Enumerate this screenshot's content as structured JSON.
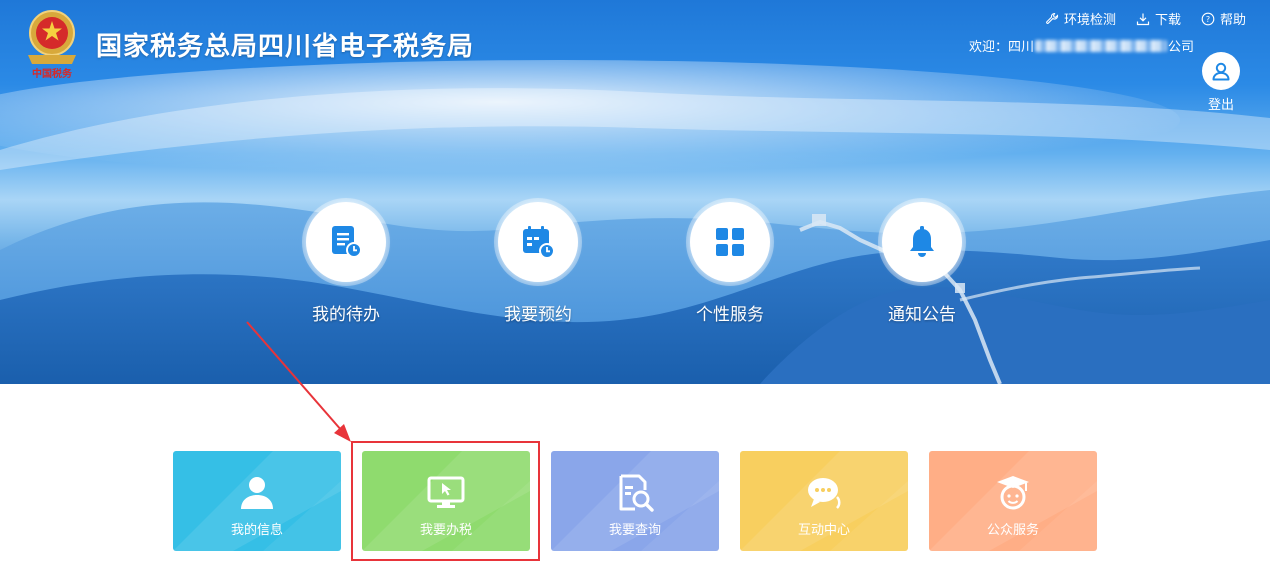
{
  "header": {
    "site_title": "国家税务总局四川省电子税务局",
    "logo_caption": "中国税务",
    "links": [
      {
        "label": "环境检测",
        "icon": "wrench-icon"
      },
      {
        "label": "下载",
        "icon": "download-icon"
      },
      {
        "label": "帮助",
        "icon": "help-icon"
      }
    ],
    "welcome_prefix": "欢迎：四川",
    "welcome_suffix": "公司",
    "logout_label": "登出"
  },
  "quick_nav": [
    {
      "label": "我的待办",
      "icon": "todo-list-icon"
    },
    {
      "label": "我要预约",
      "icon": "calendar-icon"
    },
    {
      "label": "个性服务",
      "icon": "grid-icon"
    },
    {
      "label": "通知公告",
      "icon": "bell-icon"
    }
  ],
  "tiles": [
    {
      "label": "我的信息",
      "icon": "user-icon",
      "color": "#35bfe6"
    },
    {
      "label": "我要办税",
      "icon": "monitor-icon",
      "color": "#8fdb6e"
    },
    {
      "label": "我要查询",
      "icon": "search-document-icon",
      "color": "#8aa6ea"
    },
    {
      "label": "互动中心",
      "icon": "chat-icon",
      "color": "#f8cf5f"
    },
    {
      "label": "公众服务",
      "icon": "graduate-icon",
      "color": "#ffae86"
    }
  ],
  "colors": {
    "accent": "#1e88e5",
    "annotation_red": "#e8343a"
  }
}
